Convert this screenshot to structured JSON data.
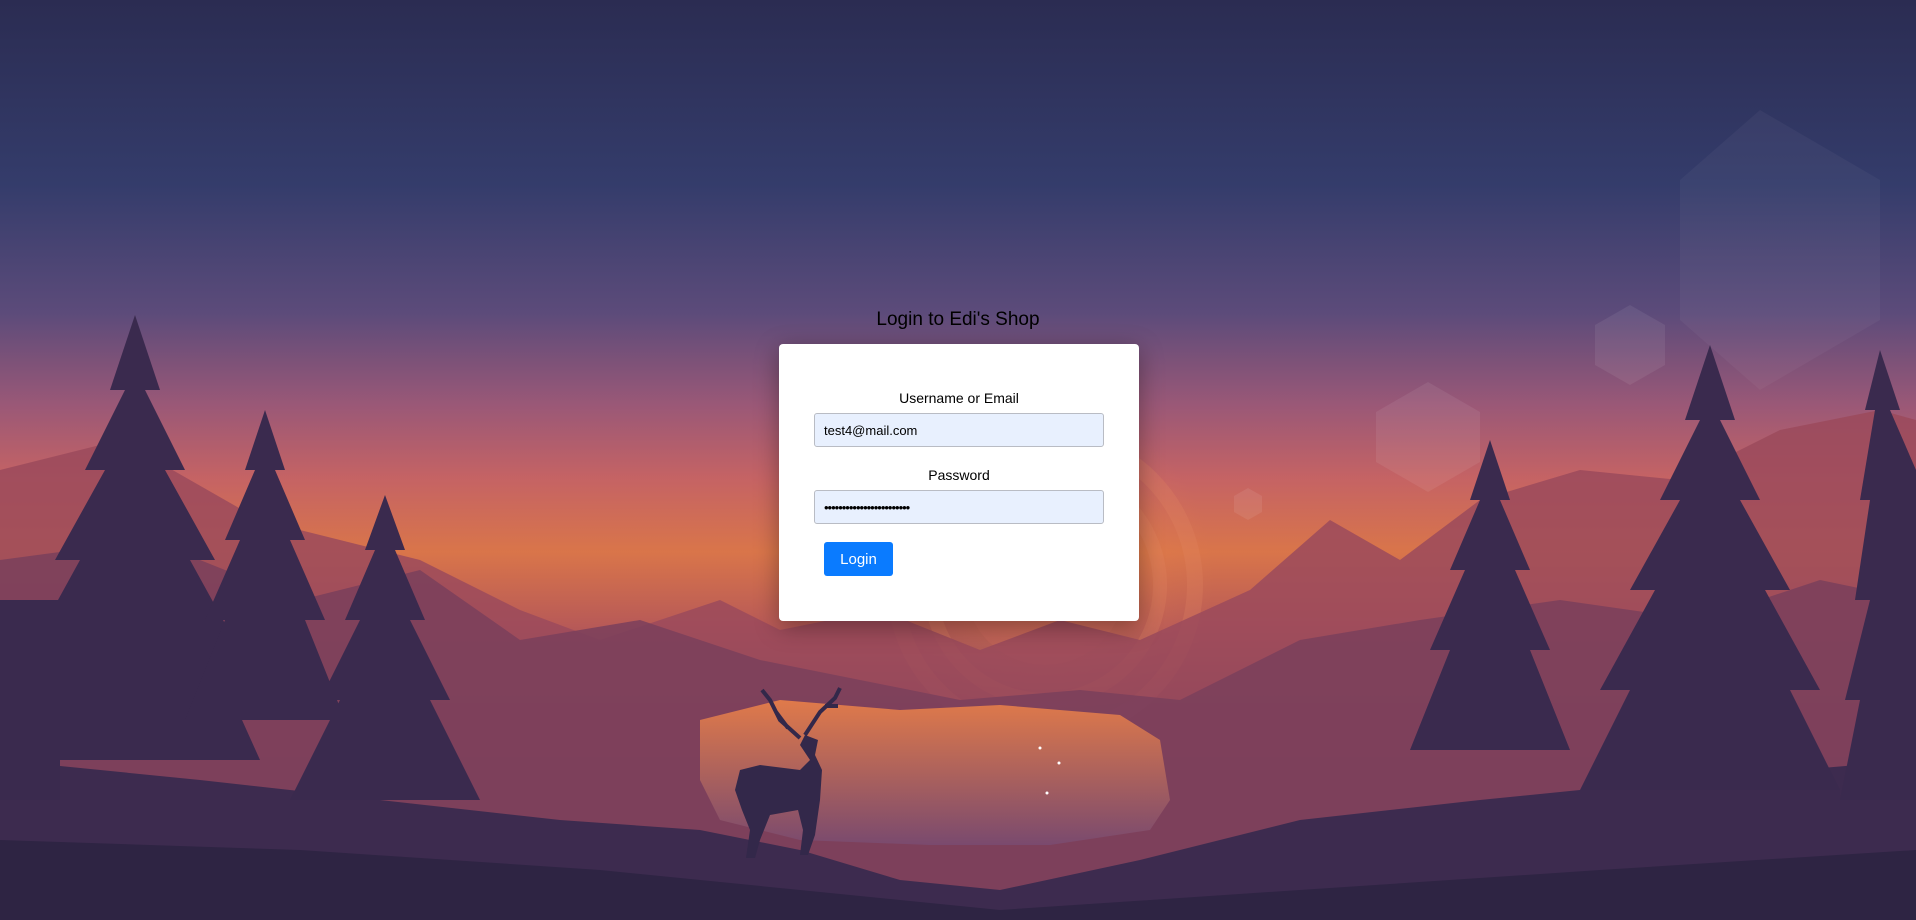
{
  "page": {
    "title": "Login to Edi's Shop"
  },
  "form": {
    "username_label": "Username or Email",
    "username_value": "test4@mail.com",
    "password_label": "Password",
    "password_value": "••••••••••••••••••••••••",
    "login_button": "Login"
  },
  "colors": {
    "button": "#0a7bff",
    "input_bg": "#e8f0fe",
    "sky_top": "#2b2c52",
    "sunset": "#d9754a"
  }
}
